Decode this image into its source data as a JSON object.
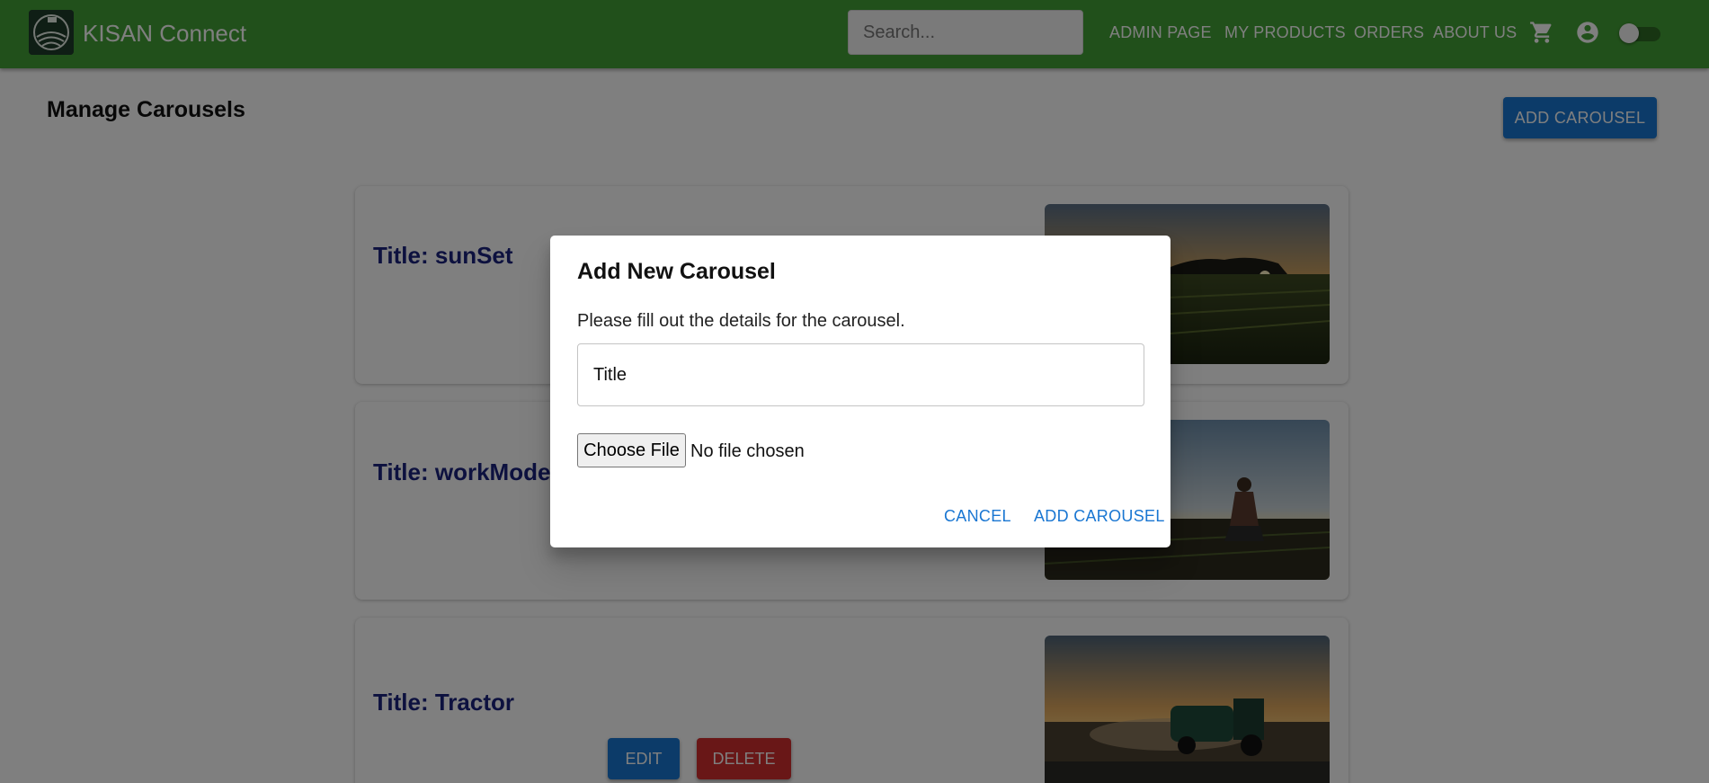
{
  "app": {
    "brand": "KISAN Connect",
    "logo_icon": "farm-globe-logo",
    "accent_color": "#43a136"
  },
  "search": {
    "placeholder": "Search..."
  },
  "nav": {
    "links": [
      "ADMIN PAGE",
      "MY PRODUCTS",
      "ORDERS",
      "ABOUT US"
    ],
    "icons": [
      "shopping-cart-icon",
      "account-circle-icon"
    ],
    "dark_mode_toggle": {
      "on": false
    }
  },
  "page": {
    "title": "Manage Carousels",
    "add_button": "ADD CAROUSEL"
  },
  "carousels": [
    {
      "title": "Title: sunSet",
      "image": "sunset-cornfield-photo"
    },
    {
      "title": "Title: workMode",
      "image": "farmer-kneeling-field-photo"
    },
    {
      "title": "Title: Tractor",
      "image": "tractor-baler-dusk-photo",
      "edit_label": "EDIT",
      "delete_label": "DELETE"
    }
  ],
  "dialog": {
    "title": "Add New Carousel",
    "description": "Please fill out the details for the carousel.",
    "title_input": {
      "placeholder": "Title",
      "value": ""
    },
    "file_button": "Choose File",
    "file_status": "No file chosen",
    "cancel_label": "CANCEL",
    "submit_label": "ADD CAROUSEL"
  },
  "colors": {
    "primary": "#1976d2",
    "danger": "#d32f2f",
    "card_title": "#1a237e"
  }
}
